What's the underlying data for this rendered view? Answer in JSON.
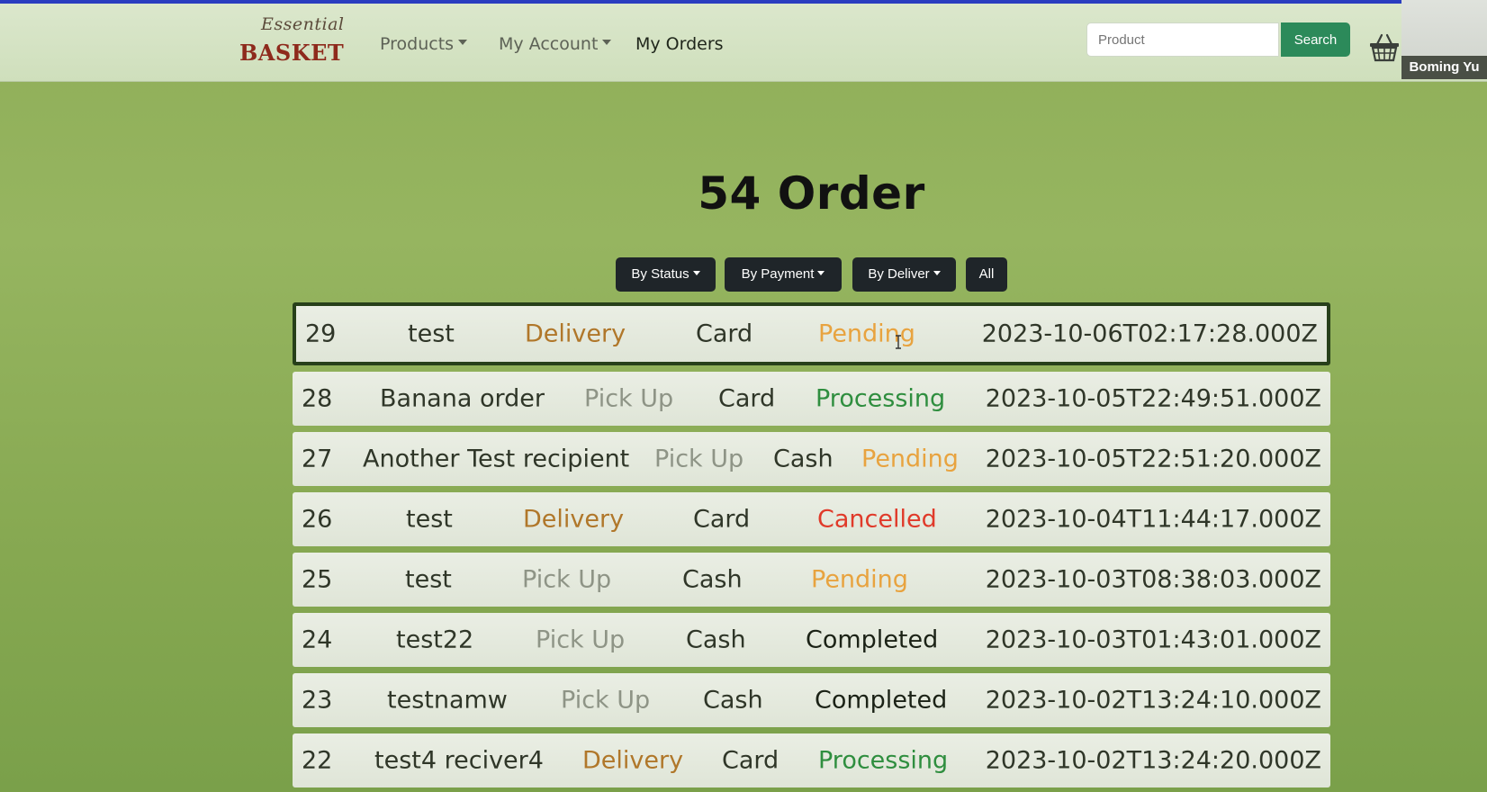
{
  "header": {
    "brand_script": "Essential",
    "brand_word": "BASKET",
    "nav_products": "Products",
    "nav_account": "My Account",
    "nav_orders": "My Orders",
    "search_placeholder": "Product",
    "search_button": "Search",
    "user_name": "Boming Yu"
  },
  "page": {
    "title": "54 Order"
  },
  "filters": {
    "by_status": "By Status",
    "by_payment": "By Payment",
    "by_deliver": "By Deliver",
    "all": "All"
  },
  "colors": {
    "delivery": "#b0772a",
    "pick_up": "#8e9486",
    "pending": "#e8a33f",
    "processing": "#2f8e3f",
    "cancelled": "#e03a2a",
    "completed": "#1b2216"
  },
  "orders": [
    {
      "id": "29",
      "recipient": "test",
      "method": "Delivery",
      "payment": "Card",
      "status": "Pending",
      "date": "2023-10-06T02:17:28.000Z"
    },
    {
      "id": "28",
      "recipient": "Banana order",
      "method": "Pick Up",
      "payment": "Card",
      "status": "Processing",
      "date": "2023-10-05T22:49:51.000Z"
    },
    {
      "id": "27",
      "recipient": "Another Test recipient",
      "method": "Pick Up",
      "payment": "Cash",
      "status": "Pending",
      "date": "2023-10-05T22:51:20.000Z"
    },
    {
      "id": "26",
      "recipient": "test",
      "method": "Delivery",
      "payment": "Card",
      "status": "Cancelled",
      "date": "2023-10-04T11:44:17.000Z"
    },
    {
      "id": "25",
      "recipient": "test",
      "method": "Pick Up",
      "payment": "Cash",
      "status": "Pending",
      "date": "2023-10-03T08:38:03.000Z"
    },
    {
      "id": "24",
      "recipient": "test22",
      "method": "Pick Up",
      "payment": "Cash",
      "status": "Completed",
      "date": "2023-10-03T01:43:01.000Z"
    },
    {
      "id": "23",
      "recipient": "testnamw",
      "method": "Pick Up",
      "payment": "Cash",
      "status": "Completed",
      "date": "2023-10-02T13:24:10.000Z"
    },
    {
      "id": "22",
      "recipient": "test4 reciver4",
      "method": "Delivery",
      "payment": "Card",
      "status": "Processing",
      "date": "2023-10-02T13:24:20.000Z"
    }
  ]
}
